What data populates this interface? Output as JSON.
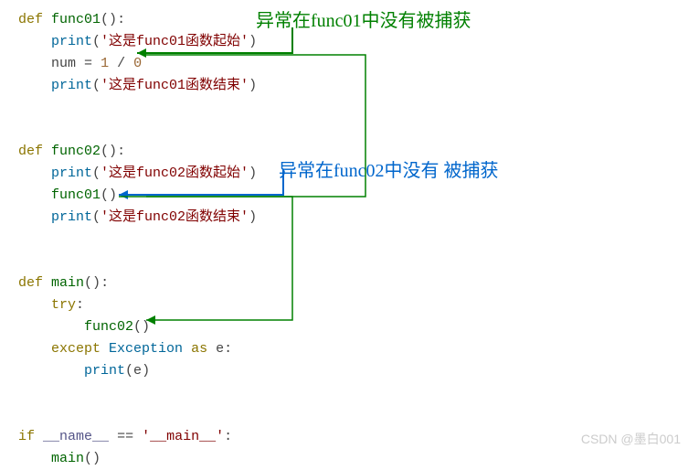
{
  "annotations": {
    "a1": "异常在func01中没有被捕获",
    "a2": "异常在func02中没有  被捕获"
  },
  "code": {
    "kw_def": "def",
    "kw_try": "try",
    "kw_except": "except",
    "kw_as": "as",
    "kw_if": "if",
    "fn_func01": "func01",
    "fn_func02": "func02",
    "fn_main": "main",
    "fn_print": "print",
    "cls_exception": "Exception",
    "var_num": "num",
    "var_e": "e",
    "var_name": "__name__",
    "op_eq": "=",
    "op_eqeq": "==",
    "op_div": "/",
    "num_1": "1",
    "num_0": "0",
    "str_f01_start": "'这是func01函数起始'",
    "str_f01_end": "'这是func01函数结束'",
    "str_f02_start": "'这是func02函数起始'",
    "str_f02_end": "'这是func02函数结束'",
    "str_main": "'__main__'",
    "paren_open": "(",
    "paren_close": ")",
    "colon": ":",
    "empty_parens": "()"
  },
  "watermark": "CSDN @墨白001"
}
